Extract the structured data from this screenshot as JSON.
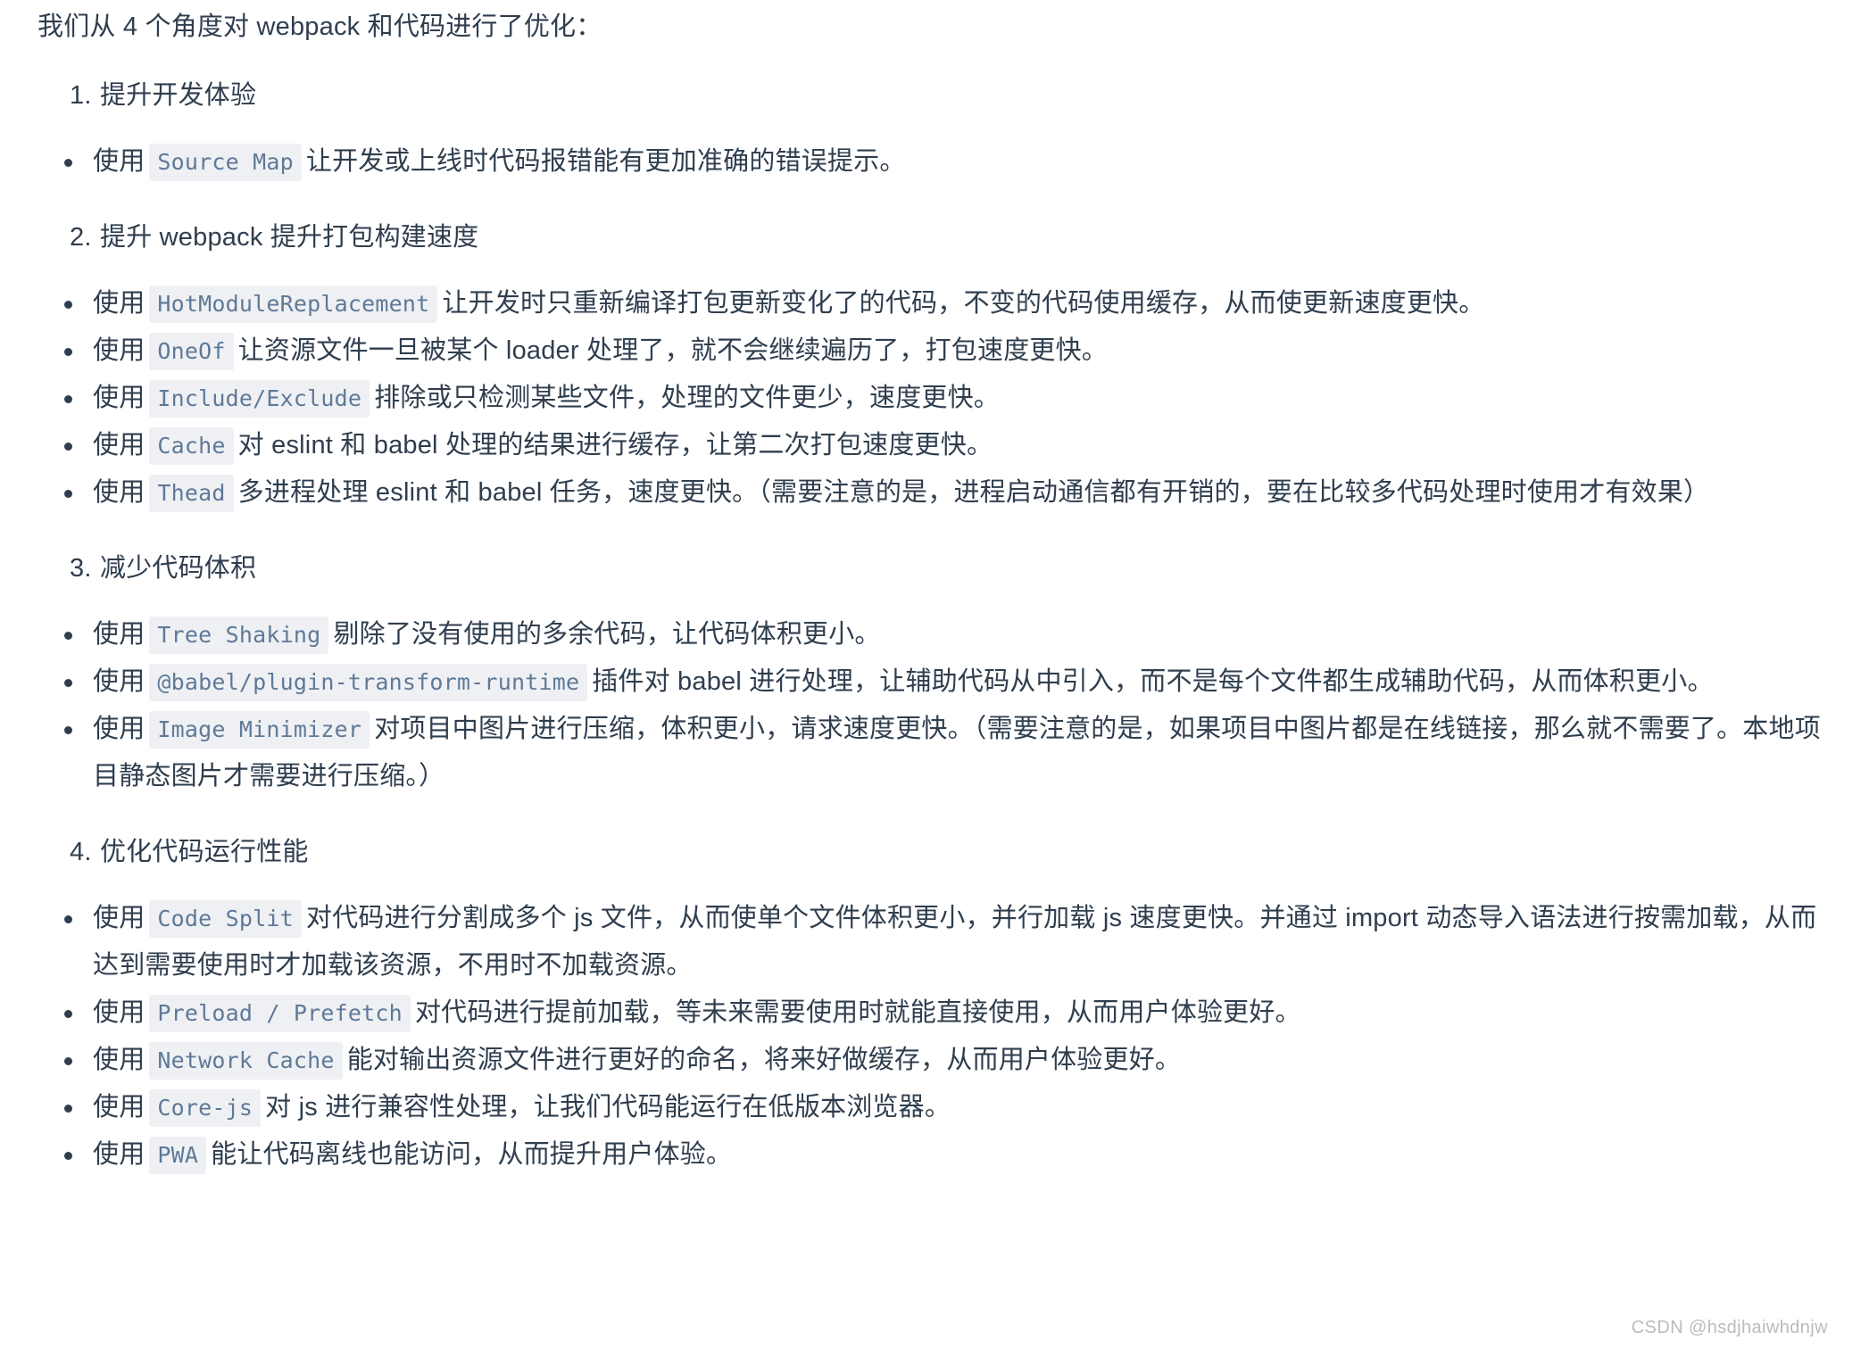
{
  "document": {
    "intro": "我们从 4 个角度对 webpack 和代码进行了优化：",
    "watermark": "CSDN @hsdjhaiwhdnjw",
    "colors": {
      "text": "#2f3e4e",
      "code_text": "#5f7998",
      "code_background": "#eef0f3",
      "page_background": "#ffffff",
      "watermark": "#b9bcc0"
    },
    "sections": [
      {
        "number": "1.",
        "title": "提升开发体验",
        "items": [
          {
            "prefix": "使用",
            "code": "Source Map",
            "suffix": "让开发或上线时代码报错能有更加准确的错误提示。"
          }
        ]
      },
      {
        "number": "2.",
        "title": "提升 webpack 提升打包构建速度",
        "items": [
          {
            "prefix": "使用",
            "code": "HotModuleReplacement",
            "suffix": "让开发时只重新编译打包更新变化了的代码，不变的代码使用缓存，从而使更新速度更快。"
          },
          {
            "prefix": "使用",
            "code": "OneOf",
            "suffix": "让资源文件一旦被某个 loader 处理了，就不会继续遍历了，打包速度更快。"
          },
          {
            "prefix": "使用",
            "code": "Include/Exclude",
            "suffix": "排除或只检测某些文件，处理的文件更少，速度更快。"
          },
          {
            "prefix": "使用",
            "code": "Cache",
            "suffix": "对 eslint 和 babel 处理的结果进行缓存，让第二次打包速度更快。"
          },
          {
            "prefix": "使用",
            "code": "Thead",
            "suffix": "多进程处理 eslint 和 babel 任务，速度更快。（需要注意的是，进程启动通信都有开销的，要在比较多代码处理时使用才有效果）"
          }
        ]
      },
      {
        "number": "3.",
        "title": "减少代码体积",
        "items": [
          {
            "prefix": "使用",
            "code": "Tree Shaking",
            "suffix": "剔除了没有使用的多余代码，让代码体积更小。"
          },
          {
            "prefix": "使用",
            "code": "@babel/plugin-transform-runtime",
            "suffix": "插件对 babel 进行处理，让辅助代码从中引入，而不是每个文件都生成辅助代码，从而体积更小。"
          },
          {
            "prefix": "使用",
            "code": "Image Minimizer",
            "suffix": "对项目中图片进行压缩，体积更小，请求速度更快。（需要注意的是，如果项目中图片都是在线链接，那么就不需要了。本地项目静态图片才需要进行压缩。）"
          }
        ]
      },
      {
        "number": "4.",
        "title": "优化代码运行性能",
        "items": [
          {
            "prefix": "使用",
            "code": "Code Split",
            "suffix": "对代码进行分割成多个 js 文件，从而使单个文件体积更小，并行加载 js 速度更快。并通过 import 动态导入语法进行按需加载，从而达到需要使用时才加载该资源，不用时不加载资源。"
          },
          {
            "prefix": "使用",
            "code": "Preload / Prefetch",
            "suffix": "对代码进行提前加载，等未来需要使用时就能直接使用，从而用户体验更好。"
          },
          {
            "prefix": "使用",
            "code": "Network Cache",
            "suffix": "能对输出资源文件进行更好的命名，将来好做缓存，从而用户体验更好。"
          },
          {
            "prefix": "使用",
            "code": "Core-js",
            "suffix": "对 js 进行兼容性处理，让我们代码能运行在低版本浏览器。"
          },
          {
            "prefix": "使用",
            "code": "PWA",
            "suffix": "能让代码离线也能访问，从而提升用户体验。"
          }
        ]
      }
    ]
  }
}
